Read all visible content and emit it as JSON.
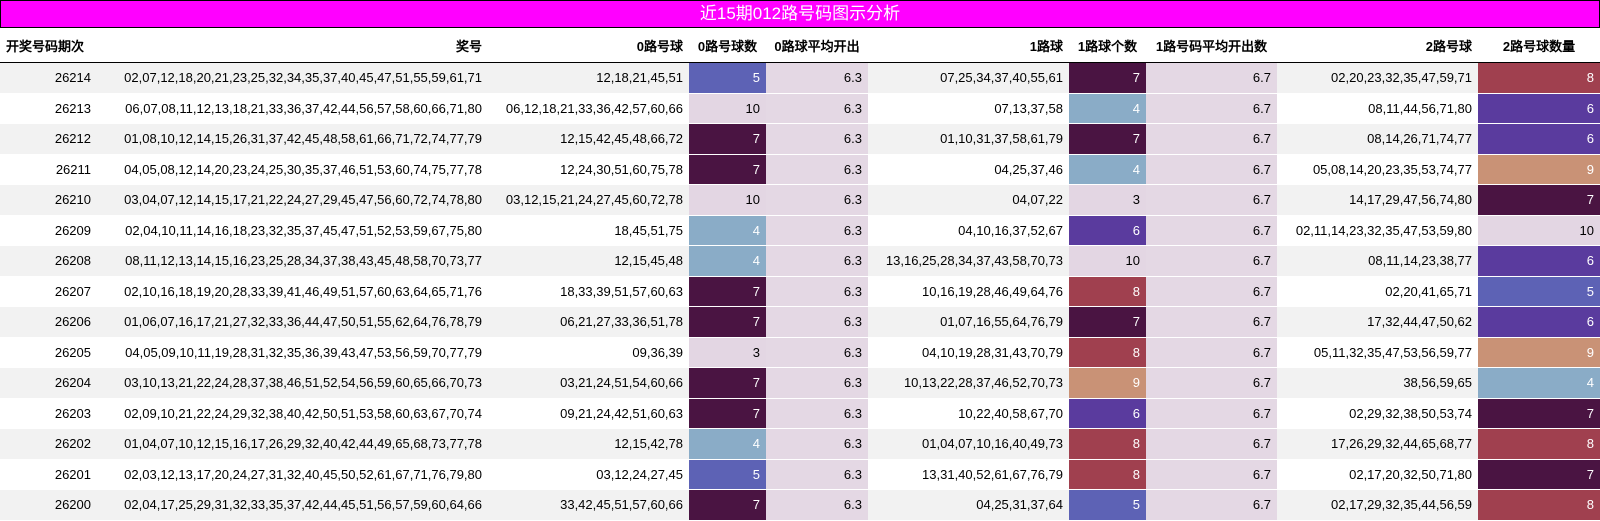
{
  "title": "近15期012路号码图示分析",
  "headers": [
    "开奖号码期次",
    "奖号",
    "0路号球",
    "0路号球数",
    "0路球平均开出",
    "1路球",
    "1路球个数",
    "1路号码平均开出数",
    "2路号球",
    "2路号球数量"
  ],
  "colors": {
    "title_bg": "#ff00ff",
    "count_3": "#e3d6e3",
    "count_4": "#8aacc7",
    "count_5": "#5d62b5",
    "count_6": "#5a3b9e",
    "count_7": "#4a1442",
    "count_8": "#a0404f",
    "count_9": "#c99276",
    "count_10": "#e3d6e3"
  },
  "rows": [
    {
      "period": "26214",
      "numbers": "02,07,12,18,20,21,23,25,32,34,35,37,40,45,47,51,55,59,61,71",
      "r0": "12,18,21,45,51",
      "c0": "5",
      "avg0": "6.3",
      "r1": "07,25,34,37,40,55,61",
      "c1": "7",
      "avg1": "6.7",
      "r2": "02,20,23,32,35,47,59,71",
      "c2": "8"
    },
    {
      "period": "26213",
      "numbers": "06,07,08,11,12,13,18,21,33,36,37,42,44,56,57,58,60,66,71,80",
      "r0": "06,12,18,21,33,36,42,57,60,66",
      "c0": "10",
      "avg0": "6.3",
      "r1": "07,13,37,58",
      "c1": "4",
      "avg1": "6.7",
      "r2": "08,11,44,56,71,80",
      "c2": "6"
    },
    {
      "period": "26212",
      "numbers": "01,08,10,12,14,15,26,31,37,42,45,48,58,61,66,71,72,74,77,79",
      "r0": "12,15,42,45,48,66,72",
      "c0": "7",
      "avg0": "6.3",
      "r1": "01,10,31,37,58,61,79",
      "c1": "7",
      "avg1": "6.7",
      "r2": "08,14,26,71,74,77",
      "c2": "6"
    },
    {
      "period": "26211",
      "numbers": "04,05,08,12,14,20,23,24,25,30,35,37,46,51,53,60,74,75,77,78",
      "r0": "12,24,30,51,60,75,78",
      "c0": "7",
      "avg0": "6.3",
      "r1": "04,25,37,46",
      "c1": "4",
      "avg1": "6.7",
      "r2": "05,08,14,20,23,35,53,74,77",
      "c2": "9"
    },
    {
      "period": "26210",
      "numbers": "03,04,07,12,14,15,17,21,22,24,27,29,45,47,56,60,72,74,78,80",
      "r0": "03,12,15,21,24,27,45,60,72,78",
      "c0": "10",
      "avg0": "6.3",
      "r1": "04,07,22",
      "c1": "3",
      "avg1": "6.7",
      "r2": "14,17,29,47,56,74,80",
      "c2": "7"
    },
    {
      "period": "26209",
      "numbers": "02,04,10,11,14,16,18,23,32,35,37,45,47,51,52,53,59,67,75,80",
      "r0": "18,45,51,75",
      "c0": "4",
      "avg0": "6.3",
      "r1": "04,10,16,37,52,67",
      "c1": "6",
      "avg1": "6.7",
      "r2": "02,11,14,23,32,35,47,53,59,80",
      "c2": "10"
    },
    {
      "period": "26208",
      "numbers": "08,11,12,13,14,15,16,23,25,28,34,37,38,43,45,48,58,70,73,77",
      "r0": "12,15,45,48",
      "c0": "4",
      "avg0": "6.3",
      "r1": "13,16,25,28,34,37,43,58,70,73",
      "c1": "10",
      "avg1": "6.7",
      "r2": "08,11,14,23,38,77",
      "c2": "6"
    },
    {
      "period": "26207",
      "numbers": "02,10,16,18,19,20,28,33,39,41,46,49,51,57,60,63,64,65,71,76",
      "r0": "18,33,39,51,57,60,63",
      "c0": "7",
      "avg0": "6.3",
      "r1": "10,16,19,28,46,49,64,76",
      "c1": "8",
      "avg1": "6.7",
      "r2": "02,20,41,65,71",
      "c2": "5"
    },
    {
      "period": "26206",
      "numbers": "01,06,07,16,17,21,27,32,33,36,44,47,50,51,55,62,64,76,78,79",
      "r0": "06,21,27,33,36,51,78",
      "c0": "7",
      "avg0": "6.3",
      "r1": "01,07,16,55,64,76,79",
      "c1": "7",
      "avg1": "6.7",
      "r2": "17,32,44,47,50,62",
      "c2": "6"
    },
    {
      "period": "26205",
      "numbers": "04,05,09,10,11,19,28,31,32,35,36,39,43,47,53,56,59,70,77,79",
      "r0": "09,36,39",
      "c0": "3",
      "avg0": "6.3",
      "r1": "04,10,19,28,31,43,70,79",
      "c1": "8",
      "avg1": "6.7",
      "r2": "05,11,32,35,47,53,56,59,77",
      "c2": "9"
    },
    {
      "period": "26204",
      "numbers": "03,10,13,21,22,24,28,37,38,46,51,52,54,56,59,60,65,66,70,73",
      "r0": "03,21,24,51,54,60,66",
      "c0": "7",
      "avg0": "6.3",
      "r1": "10,13,22,28,37,46,52,70,73",
      "c1": "9",
      "avg1": "6.7",
      "r2": "38,56,59,65",
      "c2": "4"
    },
    {
      "period": "26203",
      "numbers": "02,09,10,21,22,24,29,32,38,40,42,50,51,53,58,60,63,67,70,74",
      "r0": "09,21,24,42,51,60,63",
      "c0": "7",
      "avg0": "6.3",
      "r1": "10,22,40,58,67,70",
      "c1": "6",
      "avg1": "6.7",
      "r2": "02,29,32,38,50,53,74",
      "c2": "7"
    },
    {
      "period": "26202",
      "numbers": "01,04,07,10,12,15,16,17,26,29,32,40,42,44,49,65,68,73,77,78",
      "r0": "12,15,42,78",
      "c0": "4",
      "avg0": "6.3",
      "r1": "01,04,07,10,16,40,49,73",
      "c1": "8",
      "avg1": "6.7",
      "r2": "17,26,29,32,44,65,68,77",
      "c2": "8"
    },
    {
      "period": "26201",
      "numbers": "02,03,12,13,17,20,24,27,31,32,40,45,50,52,61,67,71,76,79,80",
      "r0": "03,12,24,27,45",
      "c0": "5",
      "avg0": "6.3",
      "r1": "13,31,40,52,61,67,76,79",
      "c1": "8",
      "avg1": "6.7",
      "r2": "02,17,20,32,50,71,80",
      "c2": "7"
    },
    {
      "period": "26200",
      "numbers": "02,04,17,25,29,31,32,33,35,37,42,44,45,51,56,57,59,60,64,66",
      "r0": "33,42,45,51,57,60,66",
      "c0": "7",
      "avg0": "6.3",
      "r1": "04,25,31,37,64",
      "c1": "5",
      "avg1": "6.7",
      "r2": "02,17,29,32,35,44,56,59",
      "c2": "8"
    }
  ]
}
